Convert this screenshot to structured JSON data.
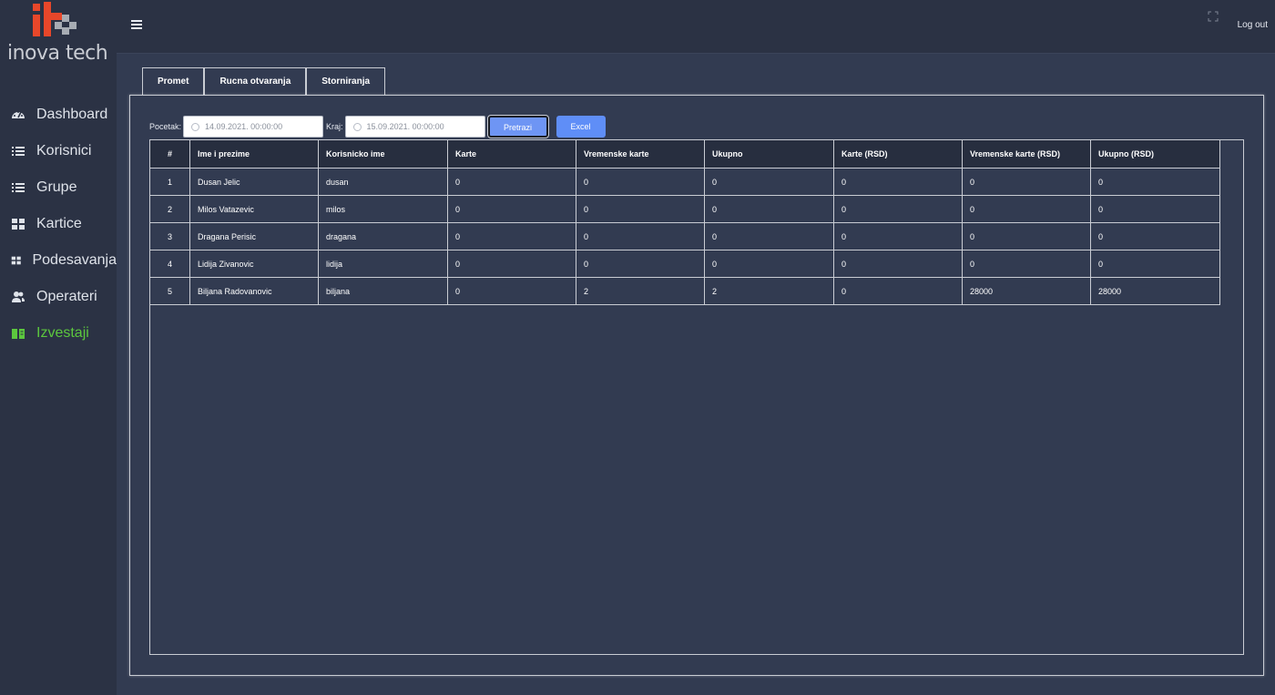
{
  "brand": {
    "logo_text": "inova tech",
    "colors": {
      "accent_red": "#e8472a",
      "accent_gray": "#a7acb3",
      "nav_active": "#5cc73e",
      "button_blue": "#6e95f4"
    }
  },
  "sidebar": {
    "items": [
      {
        "label": "Dashboard",
        "icon": "tachometer-icon"
      },
      {
        "label": "Korisnici",
        "icon": "list-icon"
      },
      {
        "label": "Grupe",
        "icon": "list-icon"
      },
      {
        "label": "Kartice",
        "icon": "grid-icon"
      },
      {
        "label": "Podesavanja",
        "icon": "grid-icon"
      },
      {
        "label": "Operateri",
        "icon": "users-icon"
      },
      {
        "label": "Izvestaji",
        "icon": "book-icon",
        "active": true
      }
    ]
  },
  "topbar": {
    "menu_icon": "hamburger-icon",
    "fullscreen_icon": "expand-icon",
    "logout_label": "Log out"
  },
  "tabs": [
    {
      "label": "Promet"
    },
    {
      "label": "Rucna otvaranja"
    },
    {
      "label": "Storniranja"
    }
  ],
  "filter": {
    "start_label": "Pocetak:",
    "start_value": "14.09.2021. 00:00:00",
    "end_label": "Kraj:",
    "end_value": "15.09.2021. 00:00:00",
    "search_label": "Pretrazi",
    "excel_label": "Excel"
  },
  "table": {
    "headers": [
      "#",
      "Ime i prezime",
      "Korisnicko ime",
      "Karte",
      "Vremenske karte",
      "Ukupno",
      "Karte (RSD)",
      "Vremenske karte (RSD)",
      "Ukupno (RSD)"
    ],
    "rows": [
      [
        "1",
        "Dusan Jelic",
        "dusan",
        "0",
        "0",
        "0",
        "0",
        "0",
        "0"
      ],
      [
        "2",
        "Milos Vatazevic",
        "milos",
        "0",
        "0",
        "0",
        "0",
        "0",
        "0"
      ],
      [
        "3",
        "Dragana Perisic",
        "dragana",
        "0",
        "0",
        "0",
        "0",
        "0",
        "0"
      ],
      [
        "4",
        "Lidija Zivanovic",
        "lidija",
        "0",
        "0",
        "0",
        "0",
        "0",
        "0"
      ],
      [
        "5",
        "Biljana Radovanovic",
        "biljana",
        "0",
        "2",
        "2",
        "0",
        "28000",
        "28000"
      ]
    ]
  }
}
